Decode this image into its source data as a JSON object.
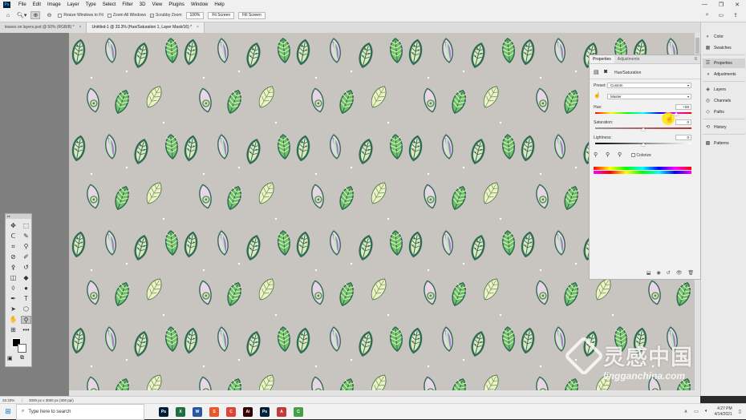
{
  "app": {
    "logo": "Ps",
    "window_controls": [
      "—",
      "❐",
      "✕"
    ]
  },
  "menu": [
    "File",
    "Edit",
    "Image",
    "Layer",
    "Type",
    "Select",
    "Filter",
    "3D",
    "View",
    "Plugins",
    "Window",
    "Help"
  ],
  "options": {
    "resize_windows_to_fit": "Resize Windows to Fit",
    "zoom_all_windows": "Zoom All Windows",
    "scrubby_zoom": "Scrubby Zoom",
    "percent_button": "100%",
    "fit_screen": "Fit Screen",
    "fill_screen": "Fill Screen"
  },
  "tabs": [
    {
      "label": "leaves on layers.psd @ 50% (RGB/8) *",
      "active": false
    },
    {
      "label": "Untitled-1 @ 33.3% (Hue/Saturation 1, Layer Mask/16) *",
      "active": true
    }
  ],
  "status": {
    "zoom": "33.33%",
    "doc": "3000 px x 3000 px (300 ppi)"
  },
  "dock": [
    {
      "label": "Color",
      "icon": "color-wheel-icon"
    },
    {
      "label": "Swatches",
      "icon": "swatches-icon"
    },
    {
      "label": "Properties",
      "icon": "properties-icon",
      "selected": true
    },
    {
      "label": "Adjustments",
      "icon": "adjustments-icon"
    },
    {
      "label": "Layers",
      "icon": "layers-icon"
    },
    {
      "label": "Channels",
      "icon": "channels-icon"
    },
    {
      "label": "Paths",
      "icon": "paths-icon"
    },
    {
      "label": "History",
      "icon": "history-icon"
    },
    {
      "label": "Patterns",
      "icon": "patterns-icon"
    }
  ],
  "properties": {
    "tabs": [
      "Properties",
      "Adjustments"
    ],
    "adjustment_title": "Hue/Saturation",
    "preset_label": "Preset:",
    "preset_value": "Custom",
    "channel_value": "Master",
    "hue_label": "Hue:",
    "hue_value": "+69",
    "saturation_label": "Saturation:",
    "saturation_value": "0",
    "lightness_label": "Lightness:",
    "lightness_value": "0",
    "colorize_label": "Colorize",
    "hue_level": 0.69
  },
  "taskbar": {
    "search_placeholder": "Type here to search",
    "time": "4:27 PM",
    "date": "4/14/2021",
    "apps": [
      {
        "label": "Ps",
        "color": "#001e36"
      },
      {
        "label": "X",
        "color": "#1d6f42"
      },
      {
        "label": "W",
        "color": "#2b579a"
      },
      {
        "label": "S",
        "color": "#e8572a"
      },
      {
        "label": "C",
        "color": "#db4437"
      },
      {
        "label": "Ai",
        "color": "#330000"
      },
      {
        "label": "Ps",
        "color": "#001e36"
      },
      {
        "label": "A",
        "color": "#c13b3b"
      },
      {
        "label": "C",
        "color": "#43a047"
      }
    ]
  },
  "watermark": {
    "title": "灵感中国",
    "url": "lingganchina.com"
  },
  "colors": {
    "canvas_bg": "#c8c4bf",
    "leaf_dark_green": "#2f6b55",
    "leaf_cream": "#eef3c6",
    "leaf_purple": "#a283c4",
    "leaf_mint": "#b9f1b4",
    "leaf_green_fill": "#6fc46a"
  }
}
